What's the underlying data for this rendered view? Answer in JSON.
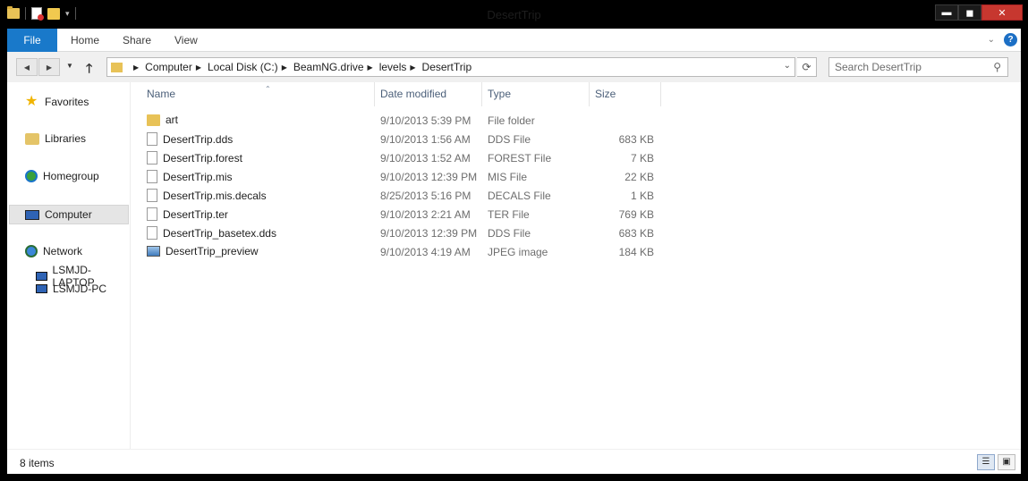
{
  "window": {
    "title": "DesertTrip",
    "controls": {
      "minimize": "▬",
      "maximize": "◼",
      "close": "✕"
    }
  },
  "ribbon": {
    "tabs": [
      {
        "label": "File"
      },
      {
        "label": "Home"
      },
      {
        "label": "Share"
      },
      {
        "label": "View"
      }
    ],
    "help": "?"
  },
  "address": {
    "crumbs": [
      "Computer",
      "Local Disk (C:)",
      "BeamNG.drive",
      "levels",
      "DesertTrip"
    ],
    "search_placeholder": "Search DesertTrip"
  },
  "nav": {
    "items": [
      {
        "label": "Favorites",
        "icon": "star-icon"
      },
      {
        "label": "Libraries",
        "icon": "libraries-icon"
      },
      {
        "label": "Homegroup",
        "icon": "homegroup-icon"
      },
      {
        "label": "Computer",
        "icon": "computer-icon",
        "selected": true
      },
      {
        "label": "Network",
        "icon": "network-icon"
      },
      {
        "label": "LSMJD-LAPTOP",
        "icon": "pc-icon"
      },
      {
        "label": "LSMJD-PC",
        "icon": "pc-icon"
      }
    ]
  },
  "columns": [
    "Name",
    "Date modified",
    "Type",
    "Size"
  ],
  "files": [
    {
      "name": "art",
      "date": "9/10/2013 5:39 PM",
      "type": "File folder",
      "size": "",
      "icon": "folder-icon"
    },
    {
      "name": "DesertTrip.dds",
      "date": "9/10/2013 1:56 AM",
      "type": "DDS File",
      "size": "683 KB",
      "icon": "file-icon"
    },
    {
      "name": "DesertTrip.forest",
      "date": "9/10/2013 1:52 AM",
      "type": "FOREST File",
      "size": "7 KB",
      "icon": "file-icon"
    },
    {
      "name": "DesertTrip.mis",
      "date": "9/10/2013 12:39 PM",
      "type": "MIS File",
      "size": "22 KB",
      "icon": "file-icon"
    },
    {
      "name": "DesertTrip.mis.decals",
      "date": "8/25/2013 5:16 PM",
      "type": "DECALS File",
      "size": "1 KB",
      "icon": "file-icon"
    },
    {
      "name": "DesertTrip.ter",
      "date": "9/10/2013 2:21 AM",
      "type": "TER File",
      "size": "769 KB",
      "icon": "file-icon"
    },
    {
      "name": "DesertTrip_basetex.dds",
      "date": "9/10/2013 12:39 PM",
      "type": "DDS File",
      "size": "683 KB",
      "icon": "file-icon"
    },
    {
      "name": "DesertTrip_preview",
      "date": "9/10/2013 4:19 AM",
      "type": "JPEG image",
      "size": "184 KB",
      "icon": "image-icon"
    }
  ],
  "status": {
    "count": "8 items"
  },
  "colors": {
    "accent": "#1979ca",
    "close": "#c7372f",
    "header_text": "#4c607a"
  }
}
